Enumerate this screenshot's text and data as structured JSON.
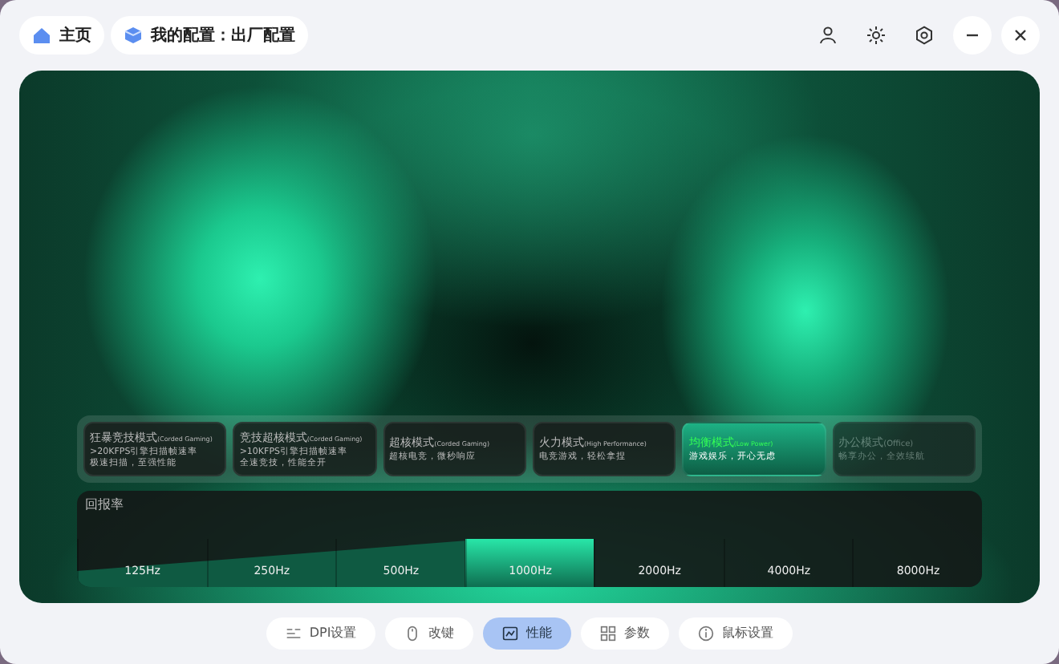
{
  "breadcrumbs": [
    {
      "label": "主页",
      "kind": "home"
    },
    {
      "label": "我的配置：出厂配置",
      "kind": "config"
    }
  ],
  "window_controls": [
    {
      "kind": "user"
    },
    {
      "kind": "brightness"
    },
    {
      "kind": "settings"
    },
    {
      "kind": "minimize"
    },
    {
      "kind": "close"
    }
  ],
  "modes": [
    {
      "title": "狂暴竞技模式",
      "tag": "(Corded Gaming)",
      "lines": [
        ">20KFPS引擎扫描帧速率",
        "极速扫描，至强性能"
      ],
      "selected": false,
      "disabled": false
    },
    {
      "title": "竞技超核模式",
      "tag": "(Corded Gaming)",
      "lines": [
        ">10KFPS引擎扫描帧速率",
        "全速竞技，性能全开"
      ],
      "selected": false,
      "disabled": false
    },
    {
      "title": "超核模式",
      "tag": "(Corded Gaming)",
      "lines": [
        "超核电竞，微秒响应"
      ],
      "selected": false,
      "disabled": false
    },
    {
      "title": "火力模式",
      "tag": "(High Performance)",
      "lines": [
        "电竞游戏，轻松拿捏"
      ],
      "selected": false,
      "disabled": false
    },
    {
      "title": "均衡模式",
      "tag": "(Low Power)",
      "lines": [
        "游戏娱乐，开心无虑"
      ],
      "selected": true,
      "disabled": false
    },
    {
      "title": "办公模式",
      "tag": "(Office)",
      "lines": [
        "畅享办公，全效续航"
      ],
      "selected": false,
      "disabled": true
    }
  ],
  "polling_rate": {
    "label": "回报率",
    "rates": [
      {
        "label": "125Hz",
        "selected": false
      },
      {
        "label": "250Hz",
        "selected": false
      },
      {
        "label": "500Hz",
        "selected": false
      },
      {
        "label": "1000Hz",
        "selected": true
      },
      {
        "label": "2000Hz",
        "selected": false
      },
      {
        "label": "4000Hz",
        "selected": false
      },
      {
        "label": "8000Hz",
        "selected": false
      }
    ]
  },
  "bottom_tabs": [
    {
      "label": "DPI设置",
      "kind": "dpi",
      "selected": false
    },
    {
      "label": "改键",
      "kind": "mouse",
      "selected": false
    },
    {
      "label": "性能",
      "kind": "performance",
      "selected": true
    },
    {
      "label": "参数",
      "kind": "grid",
      "selected": false
    },
    {
      "label": "鼠标设置",
      "kind": "info",
      "selected": false
    }
  ]
}
